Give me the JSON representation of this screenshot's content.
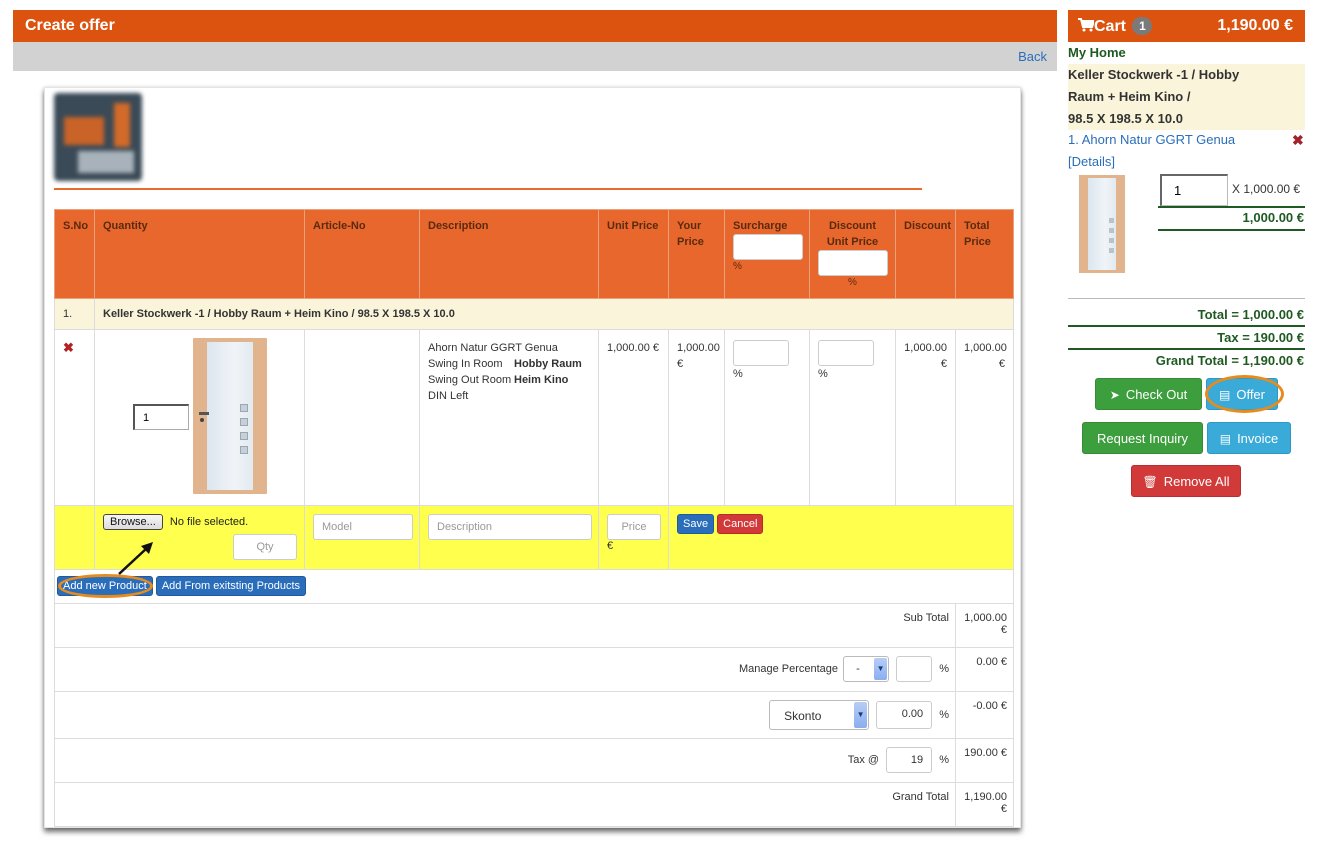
{
  "header": {
    "title": "Create offer",
    "back_label": "Back"
  },
  "table": {
    "columns": {
      "sno": "S.No",
      "quantity": "Quantity",
      "article_no": "Article-No",
      "description": "Description",
      "unit_price": "Unit Price",
      "your_price": "Your Price",
      "surcharge": "Surcharge",
      "discount_unit_price": "Discount Unit Price",
      "discount": "Discount",
      "total_price": "Total Price",
      "percent": "%"
    },
    "group": {
      "index": "1.",
      "title": "Keller Stockwerk -1 / Hobby Raum + Heim Kino / 98.5 X 198.5 X 10.0"
    },
    "item": {
      "quantity": "1",
      "article_no": "",
      "description_name": "Ahorn Natur GGRT Genua",
      "swing_in_label": "Swing In Room",
      "swing_in_value": "Hobby Raum",
      "swing_out_label": "Swing Out Room",
      "swing_out_value": "Heim Kino",
      "din": "DIN Left",
      "unit_price": "1,000.00 €",
      "your_price": "1,000.00 €",
      "surcharge_pct": "%",
      "discount_pct": "%",
      "discount": "1,000.00 €",
      "total_price": "1,000.00 €"
    },
    "new_row": {
      "browse_label": "Browse...",
      "file_status": "No file selected.",
      "qty_placeholder": "Qty",
      "model_placeholder": "Model",
      "description_placeholder": "Description",
      "price_placeholder": "Price",
      "currency": "€",
      "save_label": "Save",
      "cancel_label": "Cancel"
    },
    "add_new_product_label": "Add new Product",
    "add_existing_label": "Add From exitsting Products"
  },
  "summary": {
    "sub_total_label": "Sub Total",
    "sub_total_value": "1,000.00 €",
    "manage_percentage_label": "Manage Percentage",
    "manage_percentage_select": "-",
    "manage_percentage_input": "",
    "manage_percentage_value": "0.00 €",
    "skonto_select": "Skonto",
    "skonto_input": "0.00",
    "skonto_value": "-0.00 €",
    "tax_label": "Tax @",
    "tax_input": "19",
    "tax_value": "190.00 €",
    "grand_total_label": "Grand Total",
    "grand_total_value": "1,190.00 €",
    "percent": "%"
  },
  "cart": {
    "label": "Cart",
    "count": "1",
    "total": "1,190.00 €",
    "home": "My Home",
    "group_lines": [
      "Keller Stockwerk -1 / Hobby",
      "Raum + Heim Kino /",
      "98.5 X 198.5 X 10.0"
    ],
    "item_link": "1. Ahorn Natur GGRT Genua",
    "details_link": "[Details]",
    "item_qty": "1",
    "item_unit": "X 1,000.00 €",
    "item_total": "1,000.00 €",
    "total_line": "Total = 1,000.00 €",
    "tax_line": "Tax = 190.00 €",
    "grand_total_line": "Grand Total = 1,190.00 €",
    "buttons": {
      "checkout": "Check Out",
      "offer": "Offer",
      "request_inquiry": "Request Inquiry",
      "invoice": "Invoice",
      "remove_all": "Remove All"
    }
  },
  "colors": {
    "brand_orange": "#dc5310",
    "table_header": "#e8672c",
    "group_row": "#faf5da",
    "new_row": "#ffff4d",
    "cart_green": "#1f5a22",
    "highlight": "#e68b1e"
  }
}
